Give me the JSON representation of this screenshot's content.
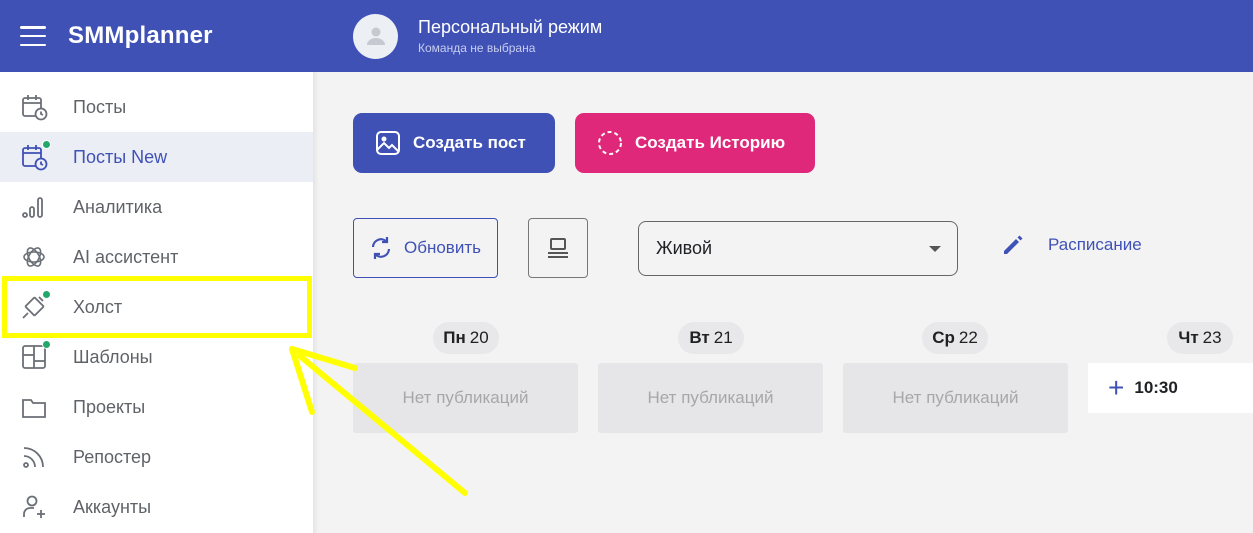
{
  "app": {
    "name": "SMMplanner"
  },
  "sidebar": {
    "items": [
      {
        "label": "Посты",
        "icon": "calendar-clock-icon",
        "active": false,
        "dot": false
      },
      {
        "label": "Посты New",
        "icon": "calendar-clock-icon",
        "active": true,
        "dot": true
      },
      {
        "label": "Аналитика",
        "icon": "bar-chart-icon",
        "active": false,
        "dot": false
      },
      {
        "label": "AI ассистент",
        "icon": "ai-knot-icon",
        "active": false,
        "dot": false
      },
      {
        "label": "Холст",
        "icon": "canvas-brush-icon",
        "active": false,
        "dot": true
      },
      {
        "label": "Шаблоны",
        "icon": "template-icon",
        "active": false,
        "dot": true
      },
      {
        "label": "Проекты",
        "icon": "folder-icon",
        "active": false,
        "dot": false
      },
      {
        "label": "Репостер",
        "icon": "rss-icon",
        "active": false,
        "dot": false
      },
      {
        "label": "Аккаунты",
        "icon": "add-user-icon",
        "active": false,
        "dot": false
      }
    ]
  },
  "topbar": {
    "mode_title": "Персональный режим",
    "mode_subtitle": "Команда не выбрана"
  },
  "actions": {
    "create_post": "Создать пост",
    "create_story": "Создать Историю",
    "refresh": "Обновить",
    "schedule": "Расписание"
  },
  "filter": {
    "selected": "Живой"
  },
  "calendar": {
    "days": [
      {
        "day": "Пн",
        "num": "20"
      },
      {
        "day": "Вт",
        "num": "21"
      },
      {
        "day": "Ср",
        "num": "22"
      },
      {
        "day": "Чт",
        "num": "23"
      }
    ],
    "empty_text": "Нет публикаций",
    "first_time": "10:30"
  },
  "colors": {
    "primary": "#3f51b5",
    "story": "#e0287a",
    "dot": "#22a86b",
    "highlight": "#ffff00"
  }
}
